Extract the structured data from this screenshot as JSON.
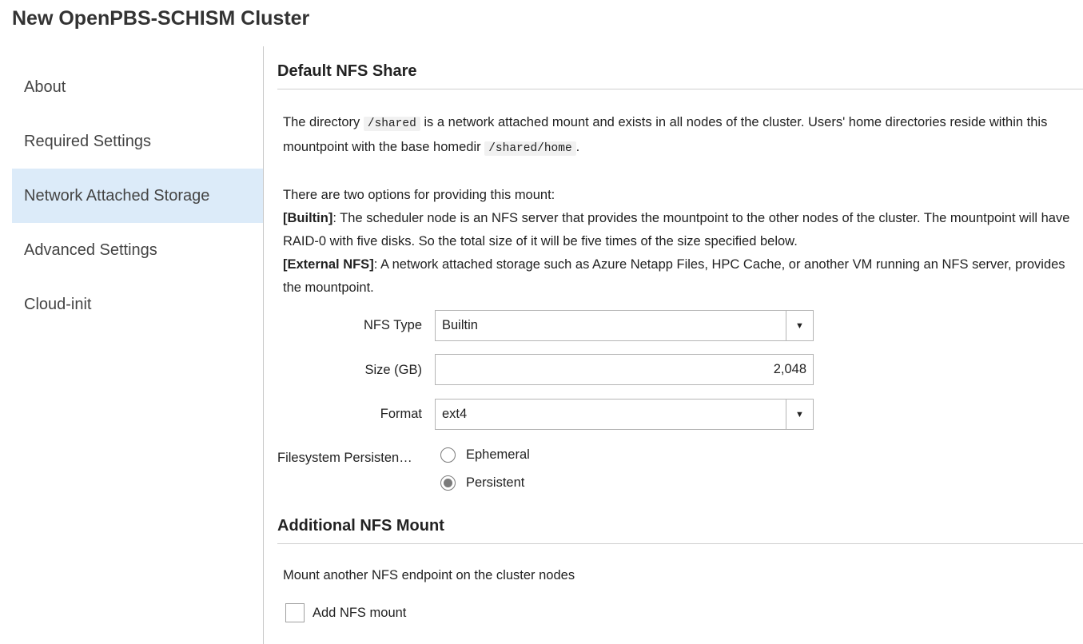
{
  "page": {
    "title": "New OpenPBS-SCHISM Cluster"
  },
  "sidebar": {
    "items": [
      {
        "label": "About",
        "active": false
      },
      {
        "label": "Required Settings",
        "active": false
      },
      {
        "label": "Network Attached Storage",
        "active": true
      },
      {
        "label": "Advanced Settings",
        "active": false
      },
      {
        "label": "Cloud-init",
        "active": false
      }
    ]
  },
  "nfs_default": {
    "heading": "Default NFS Share",
    "desc": {
      "t1": "The directory ",
      "code1": "/shared",
      "t2": " is a network attached mount and exists in all nodes of the cluster. Users' home directories reside within this mountpoint with the base homedir ",
      "code2": "/shared/home",
      "t3": "."
    },
    "options": {
      "intro": "There are two options for providing this mount:",
      "builtin_label": "[Builtin]",
      "builtin_text": ": The scheduler node is an NFS server that provides the mountpoint to the other nodes of the cluster. The mountpoint will have RAID-0 with five disks. So the total size of it will be five times of the size specified below.",
      "external_label": "[External NFS]",
      "external_text": ": A network attached storage such as Azure Netapp Files, HPC Cache, or another VM running an NFS server, provides the mountpoint."
    },
    "nfs_type": {
      "label": "NFS Type",
      "value": "Builtin"
    },
    "size": {
      "label": "Size (GB)",
      "value": "2,048"
    },
    "format": {
      "label": "Format",
      "value": "ext4"
    },
    "persistence": {
      "label": "Filesystem Persisten…",
      "options": [
        {
          "label": "Ephemeral",
          "checked": false
        },
        {
          "label": "Persistent",
          "checked": true
        }
      ]
    }
  },
  "nfs_additional": {
    "heading": "Additional NFS Mount",
    "desc": "Mount another NFS endpoint on the cluster nodes",
    "checkbox_label": "Add NFS mount",
    "checked": false
  },
  "icons": {
    "dropdown": "triangle-down-icon"
  }
}
